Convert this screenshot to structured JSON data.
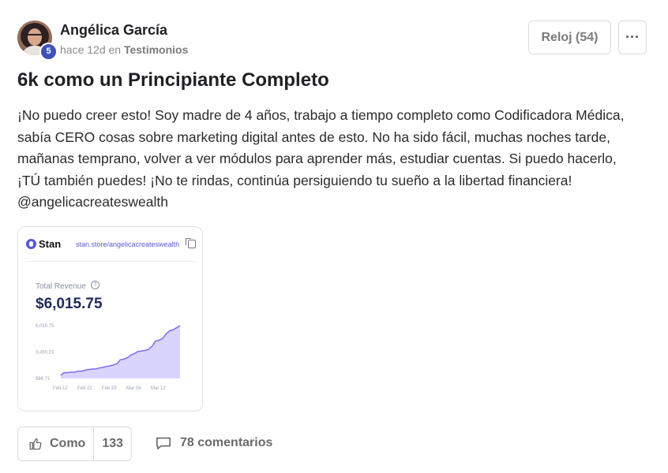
{
  "author": {
    "name": "Angélica García",
    "level": "5",
    "time_ago": "hace 12d",
    "in_word": "en",
    "category": "Testimonios"
  },
  "actions": {
    "watch_label": "Reloj (54)",
    "more_icon": "ellipsis-icon",
    "more_label": "···"
  },
  "post": {
    "title": "6k como un Principiante Completo",
    "body_lines": [
      "¡No puedo creer esto! Soy madre de 4 años, trabajo a tiempo completo como Codificadora Médica,",
      "sabía CERO cosas sobre marketing digital antes de esto. No ha sido fácil, muchas noches tarde,",
      "mañanas temprano, volver a ver módulos para aprender más, estudiar cuentas. Si puedo hacerlo,",
      "¡TÚ también puedes! ¡No te rindas, continúa persiguiendo tu sueño a la libertad financiera!",
      "@angelicacreateswealth"
    ]
  },
  "attachment": {
    "brand": "Stan",
    "url": "stan.store/angelicacreateswealth",
    "revenue_label": "Total Revenue",
    "revenue_value": "$6,015.75",
    "accent_color": "#5b5bd6"
  },
  "chart_data": {
    "type": "area",
    "title": "",
    "xlabel": "",
    "ylabel": "",
    "y_tick_labels": [
      "6,015.75",
      "3,450.23",
      "884.71"
    ],
    "x_tick_labels": [
      "Feb 12",
      "Feb 22",
      "Feb 29",
      "Mar 06",
      "Mar 12"
    ],
    "ylim": [
      884.71,
      6015.75
    ],
    "series": [
      {
        "values": [
          1200,
          1450,
          1450,
          1500,
          1500,
          1600,
          1600,
          1700,
          1750,
          1800,
          1800,
          1900,
          1950,
          2050,
          2100,
          2200,
          2300,
          2700,
          2750,
          2900,
          3150,
          3300,
          3500,
          3550,
          3600,
          3700,
          4000,
          4500,
          4600,
          4750,
          5200,
          5500,
          5600,
          5800,
          6015.75
        ]
      }
    ],
    "line_color": "#7c6cf0",
    "fill_color": "#d9d4fb"
  },
  "footer": {
    "like_label": "Como",
    "like_count": "133",
    "comments_label": "78 comentarios"
  }
}
